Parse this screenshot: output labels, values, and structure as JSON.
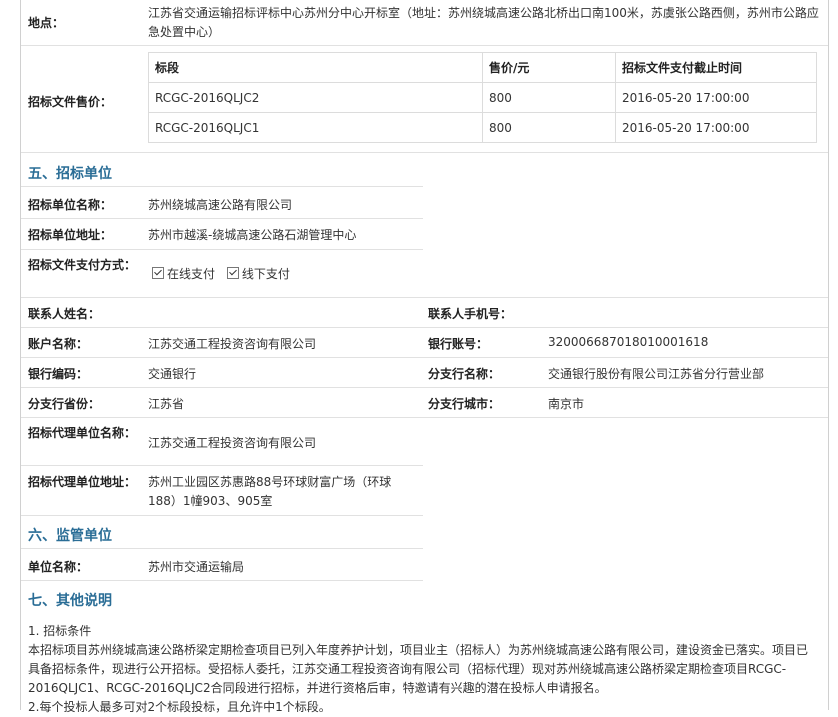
{
  "location": {
    "label": "地点：",
    "value": "江苏省交通运输招标评标中心苏州分中心开标室（地址：苏州绕城高速公路北桥出口南100米，苏虞张公路西侧，苏州市公路应急处置中心）"
  },
  "tender_doc_price": {
    "label": "招标文件售价：",
    "headers": [
      "标段",
      "售价/元",
      "招标文件支付截止时间"
    ],
    "rows": [
      [
        "RCGC-2016QLJC2",
        "800",
        "2016-05-20 17:00:00"
      ],
      [
        "RCGC-2016QLJC1",
        "800",
        "2016-05-20 17:00:00"
      ]
    ]
  },
  "section5": {
    "title": "五、招标单位",
    "tenderer_name_label": "招标单位名称：",
    "tenderer_name": "苏州绕城高速公路有限公司",
    "tenderer_addr_label": "招标单位地址：",
    "tenderer_addr": "苏州市越溪-绕城高速公路石湖管理中心",
    "pay_method_label": "招标文件支付方式：",
    "pay_online": "在线支付",
    "pay_offline": "线下支付",
    "contact_name_label": "联系人姓名：",
    "contact_phone_label": "联系人手机号：",
    "account_name_label": "账户名称：",
    "account_name": "江苏交通工程投资咨询有限公司",
    "bank_account_label": "银行账号：",
    "bank_account": "32000668701801000161​8",
    "bank_code_label": "银行编码：",
    "bank_code": "交通银行",
    "branch_name_label": "分支行名称：",
    "branch_name": "交通银行股份有限公司江苏省分行营业部",
    "branch_province_label": "分支行省份：",
    "branch_province": "江苏省",
    "branch_city_label": "分支行城市：",
    "branch_city": "南京市",
    "agent_name_label": "招标代理单位名称：",
    "agent_name": "江苏交通工程投资咨询有限公司",
    "agent_addr_label": "招标代理单位地址：",
    "agent_addr": "苏州工业园区苏惠路88号环球财富广场（环球188）1幢903、905室"
  },
  "section6": {
    "title": "六、监管单位",
    "unit_name_label": "单位名称：",
    "unit_name": "苏州市交通运输局"
  },
  "section7": {
    "title": "七、其他说明",
    "item1_title": "1. 招标条件",
    "item1_body": "本招标项目苏州绕城高速公路桥梁定期检查项目已列入年度养护计划，项目业主（招标人）为苏州绕城高速公路有限公司，建设资金已落实。项目已具备招标条件，现进行公开招标。受招标人委托，江苏交通工程投资咨询有限公司（招标代理）现对苏州绕城高速公路桥梁定期检查项目RCGC-2016QLJC1、RCGC-2016QLJC2合同段进行招标，并进行资格后审，特邀请有兴趣的潜在投标人申请报名。",
    "item2_title": "2.每个投标人最多可对2个标段投标，且允许中1个标段。"
  }
}
